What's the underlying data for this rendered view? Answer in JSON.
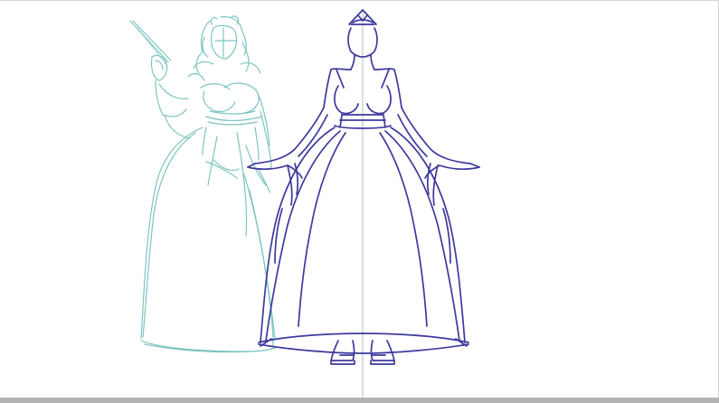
{
  "canvas": {
    "background": "#ffffff",
    "guide_color": "#c8ccd6",
    "layer_sketch_color": "#7cc4c0",
    "layer_ink_color": "#3d3a9c"
  },
  "drawing": {
    "left_figure": "fairy-godmother-sketch",
    "right_figure": "princess-dress-sketch"
  },
  "scrollbar": {
    "color": "#c9c9c9"
  }
}
